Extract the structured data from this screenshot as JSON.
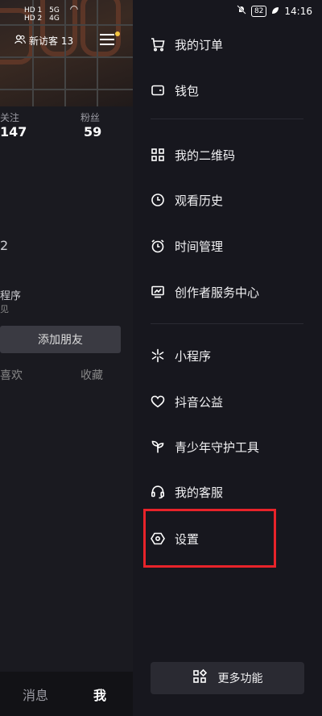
{
  "statusbar": {
    "left_signal_1": "HD 1",
    "left_signal_2": "HD 2",
    "network_1": "5G",
    "network_2": "4G",
    "battery": "82",
    "time": "14:16"
  },
  "profile": {
    "visitor_label": "新访客 13",
    "following_label": "关注",
    "following_value": "147",
    "followers_label": "粉丝",
    "followers_value": "59",
    "fragment_2": "2",
    "mini_program_text": "程序",
    "mini_program_sub": "见",
    "add_friend": "添加朋友",
    "tab_likes": "喜欢",
    "tab_favorites": "收藏"
  },
  "bottom_nav": {
    "messages": "消息",
    "me": "我"
  },
  "drawer": {
    "items": [
      {
        "label": "我的订单",
        "icon": "cart-icon"
      },
      {
        "label": "钱包",
        "icon": "wallet-icon"
      },
      {
        "label": "我的二维码",
        "icon": "qr-icon"
      },
      {
        "label": "观看历史",
        "icon": "clock-icon"
      },
      {
        "label": "时间管理",
        "icon": "alarm-icon"
      },
      {
        "label": "创作者服务中心",
        "icon": "chart-icon"
      },
      {
        "label": "小程序",
        "icon": "asterisk-icon"
      },
      {
        "label": "抖音公益",
        "icon": "heart-icon"
      },
      {
        "label": "青少年守护工具",
        "icon": "sprout-icon"
      },
      {
        "label": "我的客服",
        "icon": "headset-icon"
      },
      {
        "label": "设置",
        "icon": "hexagon-settings-icon"
      }
    ],
    "more_label": "更多功能"
  },
  "accent_colors": {
    "highlight": "#e8232a",
    "notification_dot": "#f4c542"
  }
}
